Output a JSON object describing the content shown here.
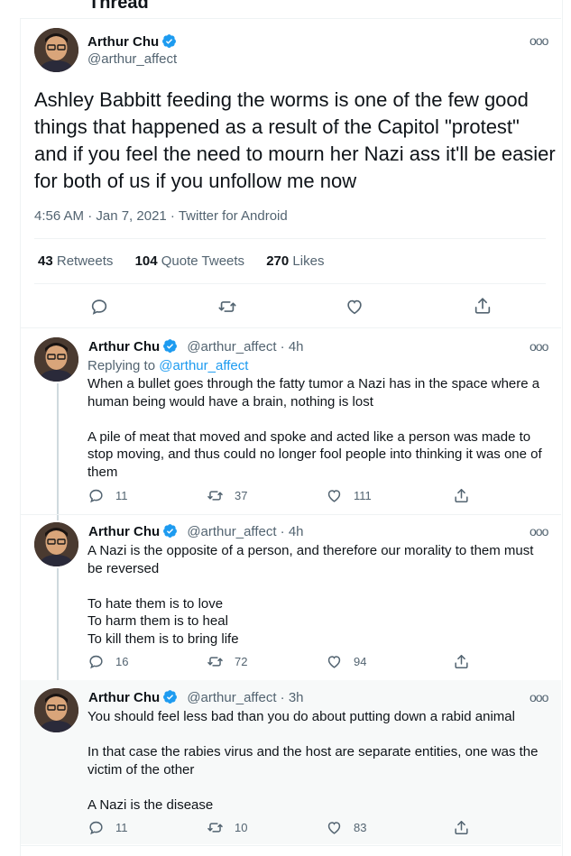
{
  "header": {
    "title": "Thread"
  },
  "main_tweet": {
    "name": "Arthur Chu",
    "handle": "@arthur_affect",
    "text": "Ashley Babbitt feeding the worms is one of the few good things that happened as a result of the Capitol \"protest\" and if you feel the need to mourn her Nazi ass it'll be easier for both of us if you unfollow me now",
    "meta": "4:56 AM · Jan 7, 2021 · Twitter for Android",
    "retweets": "43",
    "retweets_label": "Retweets",
    "quotes": "104",
    "quotes_label": "Quote Tweets",
    "likes": "270",
    "likes_label": "Likes"
  },
  "replies": [
    {
      "name": "Arthur Chu",
      "handle": "@arthur_affect",
      "time": "4h",
      "replying_prefix": "Replying to ",
      "replying_to": "@arthur_affect",
      "text": "When a bullet goes through the fatty tumor a Nazi has in the space where a human being would have a brain, nothing is lost\n\nA pile of meat that moved and spoke and acted like a person was made to stop moving, and thus could no longer fool people into thinking it was one of them",
      "reply_count": "11",
      "retweet_count": "37",
      "like_count": "111"
    },
    {
      "name": "Arthur Chu",
      "handle": "@arthur_affect",
      "time": "4h",
      "text": "A Nazi is the opposite of a person, and therefore our morality to them must be reversed\n\nTo hate them is to love\nTo harm them is to heal\nTo kill them is to bring life",
      "reply_count": "16",
      "retweet_count": "72",
      "like_count": "94"
    },
    {
      "name": "Arthur Chu",
      "handle": "@arthur_affect",
      "time": "3h",
      "text": "You should feel less bad than you do about putting down a rabid animal\n\nIn that case the rabies virus and the host are separate entities, one was the victim of the other\n\nA Nazi is the disease",
      "reply_count": "11",
      "retweet_count": "10",
      "like_count": "83"
    }
  ],
  "more_symbol": "ooo",
  "separator": " · ",
  "colors": {
    "accent": "#1d9bf0",
    "muted": "#536471",
    "text": "#0f1419"
  }
}
